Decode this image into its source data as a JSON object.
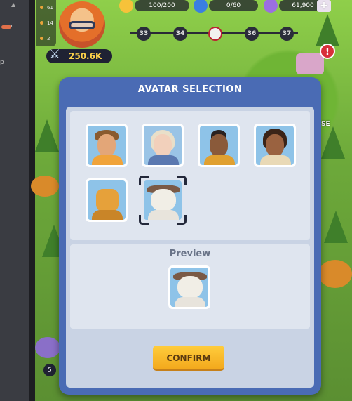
{
  "editor": {
    "marker": "x",
    "letter": "p"
  },
  "side_counters": [
    "61",
    "14",
    "2"
  ],
  "resources": {
    "energy": "100/200",
    "bolt": "0/60",
    "gems": "61,900",
    "plus": "+"
  },
  "player": {
    "power": "250.6K"
  },
  "levels": [
    "33",
    "34",
    "36",
    "37"
  ],
  "alert": "!",
  "side_text": "SE",
  "badge": "5",
  "modal": {
    "title": "AVATAR SELECTION",
    "avatars": [
      {
        "id": "bearded-man",
        "selected": false
      },
      {
        "id": "blonde-woman",
        "selected": false
      },
      {
        "id": "mohawk-man",
        "selected": false
      },
      {
        "id": "curly-woman",
        "selected": false
      },
      {
        "id": "robot",
        "selected": false
      },
      {
        "id": "yeti",
        "selected": true
      }
    ],
    "preview_label": "Preview",
    "preview_avatar": "yeti",
    "confirm_label": "CONFIRM"
  },
  "colors": {
    "modal": "#4a6bb4",
    "panel": "#c9d3e4",
    "confirm": "#ffcd3c"
  }
}
